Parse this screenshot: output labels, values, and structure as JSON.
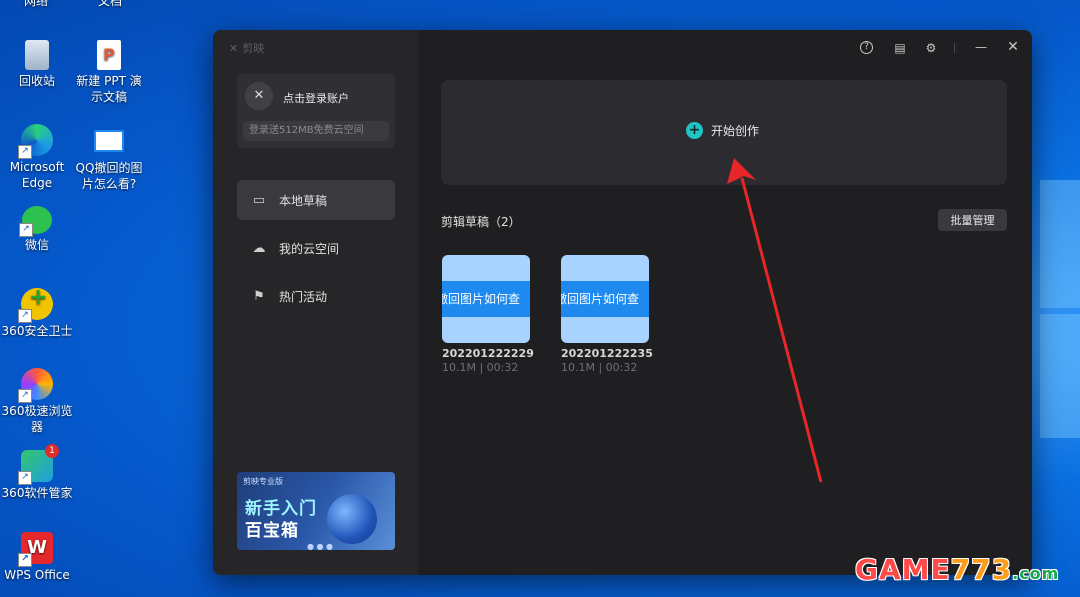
{
  "desktop": {
    "top_labels": [
      "网络",
      "文档"
    ],
    "icons": [
      {
        "label": "回收站",
        "icon": "recycle-bin-icon"
      },
      {
        "label": "新建 PPT 演示文稿",
        "icon": "ppt-file-icon"
      },
      {
        "label": "Microsoft Edge",
        "icon": "edge-browser-icon"
      },
      {
        "label": "QQ撤回的图片怎么看?",
        "icon": "image-file-icon"
      },
      {
        "label": "微信",
        "icon": "wechat-icon"
      },
      {
        "label": "360安全卫士",
        "icon": "360-security-icon"
      },
      {
        "label": "360极速浏览器",
        "icon": "360-browser-icon"
      },
      {
        "label": "360软件管家",
        "icon": "360-software-manager-icon"
      },
      {
        "label": "WPS Office",
        "icon": "wps-office-icon"
      }
    ],
    "badge_count": "1"
  },
  "app": {
    "name": "剪映",
    "login": {
      "title": "点击登录账户",
      "subtitle": "登录送512MB免费云空间"
    },
    "nav": [
      {
        "label": "本地草稿",
        "icon": "folder-icon",
        "active": true
      },
      {
        "label": "我的云空间",
        "icon": "cloud-icon",
        "active": false
      },
      {
        "label": "热门活动",
        "icon": "flag-icon",
        "active": false
      }
    ],
    "promo": {
      "brand": "剪映专业版",
      "line1": "新手入门",
      "line2": "百宝箱"
    },
    "titlebar_icons": [
      "help-icon",
      "feedback-icon",
      "settings-icon",
      "minimize-icon",
      "close-icon"
    ],
    "create_label": "开始创作",
    "section_title": "剪辑草稿（2）",
    "batch_label": "批量管理",
    "drafts": [
      {
        "thumb_text": "撤回图片如何查",
        "name": "202201222229",
        "meta": "10.1M | 00:32"
      },
      {
        "thumb_text": "撤回图片如何查",
        "name": "202201222235",
        "meta": "10.1M | 00:32"
      }
    ]
  },
  "watermark": {
    "part1": "GAME",
    "part2": "773",
    "part3": ".com"
  },
  "colors": {
    "accent": "#21c4c4",
    "annotation_arrow": "#e8262a",
    "app_bg": "#1f1f22"
  }
}
